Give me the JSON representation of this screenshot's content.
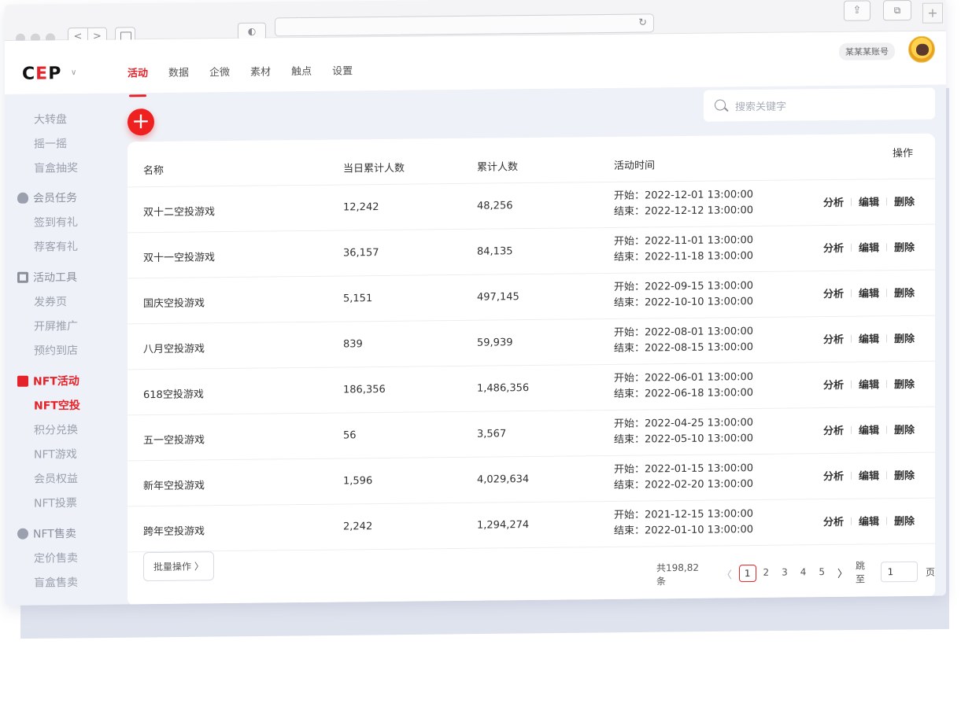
{
  "header": {
    "logo_text": "C",
    "logo_accent": "E",
    "logo_tail": "P",
    "logo_caret": "∨",
    "tabs": [
      {
        "label": "活动",
        "active": true
      },
      {
        "label": "数据"
      },
      {
        "label": "企微"
      },
      {
        "label": "素材"
      },
      {
        "label": "触点"
      },
      {
        "label": "设置"
      }
    ],
    "account": "某某某账号"
  },
  "sidebar": {
    "items": [
      {
        "label": "大转盘"
      },
      {
        "label": "摇一摇"
      },
      {
        "label": "盲盒抽奖"
      },
      {
        "label": "会员任务",
        "group": true,
        "icon": "user-icon"
      },
      {
        "label": "签到有礼"
      },
      {
        "label": "荐客有礼"
      },
      {
        "label": "活动工具",
        "group": true,
        "icon": "toolbox-icon"
      },
      {
        "label": "发券页"
      },
      {
        "label": "开屏推广"
      },
      {
        "label": "预约到店"
      },
      {
        "label": "NFT活动",
        "group": true,
        "icon": "nft-flag-icon",
        "active": true
      },
      {
        "label": "NFT空投",
        "active": true
      },
      {
        "label": "积分兑换"
      },
      {
        "label": "NFT游戏"
      },
      {
        "label": "会员权益"
      },
      {
        "label": "NFT投票"
      },
      {
        "label": "NFT售卖",
        "group": true,
        "icon": "sale-icon"
      },
      {
        "label": "定价售卖"
      },
      {
        "label": "盲盒售卖"
      }
    ]
  },
  "search": {
    "placeholder": "搜索关键字"
  },
  "table": {
    "columns": [
      "名称",
      "当日累计人数",
      "累计人数",
      "活动时间",
      "操作"
    ],
    "actions": [
      "分析",
      "编辑",
      "删除"
    ],
    "rows": [
      {
        "name": "双十二空投游戏",
        "today": "12,242",
        "total": "48,256",
        "start": "开始：2022-12-01  13:00:00",
        "end": "结束：2022-12-12  13:00:00"
      },
      {
        "name": "双十一空投游戏",
        "today": "36,157",
        "total": "84,135",
        "start": "开始：2022-11-01  13:00:00",
        "end": "结束：2022-11-18  13:00:00"
      },
      {
        "name": "国庆空投游戏",
        "today": "5,151",
        "total": "497,145",
        "start": "开始：2022-09-15  13:00:00",
        "end": "结束：2022-10-10  13:00:00"
      },
      {
        "name": "八月空投游戏",
        "today": "839",
        "total": "59,939",
        "start": "开始：2022-08-01  13:00:00",
        "end": "结束：2022-08-15  13:00:00"
      },
      {
        "name": "618空投游戏",
        "today": "186,356",
        "total": "1,486,356",
        "start": "开始：2022-06-01  13:00:00",
        "end": "结束：2022-06-18  13:00:00"
      },
      {
        "name": "五一空投游戏",
        "today": "56",
        "total": "3,567",
        "start": "开始：2022-04-25  13:00:00",
        "end": "结束：2022-05-10  13:00:00"
      },
      {
        "name": "新年空投游戏",
        "today": "1,596",
        "total": "4,029,634",
        "start": "开始：2022-01-15  13:00:00",
        "end": "结束：2022-02-20  13:00:00"
      },
      {
        "name": "跨年空投游戏",
        "today": "2,242",
        "total": "1,294,274",
        "start": "开始：2021-12-15  13:00:00",
        "end": "结束：2022-01-10  13:00:00"
      }
    ]
  },
  "footer": {
    "batch_label": "批量操作 〉",
    "total_text": "共198,82条",
    "prev": "〈",
    "pages": [
      "1",
      "2",
      "3",
      "4",
      "5"
    ],
    "next": "〉",
    "jump_label": "跳至",
    "jump_value": "1",
    "page_suffix": "页"
  },
  "colors": {
    "accent": "#e4232a",
    "sidebar_bg": "#eef1f7"
  }
}
